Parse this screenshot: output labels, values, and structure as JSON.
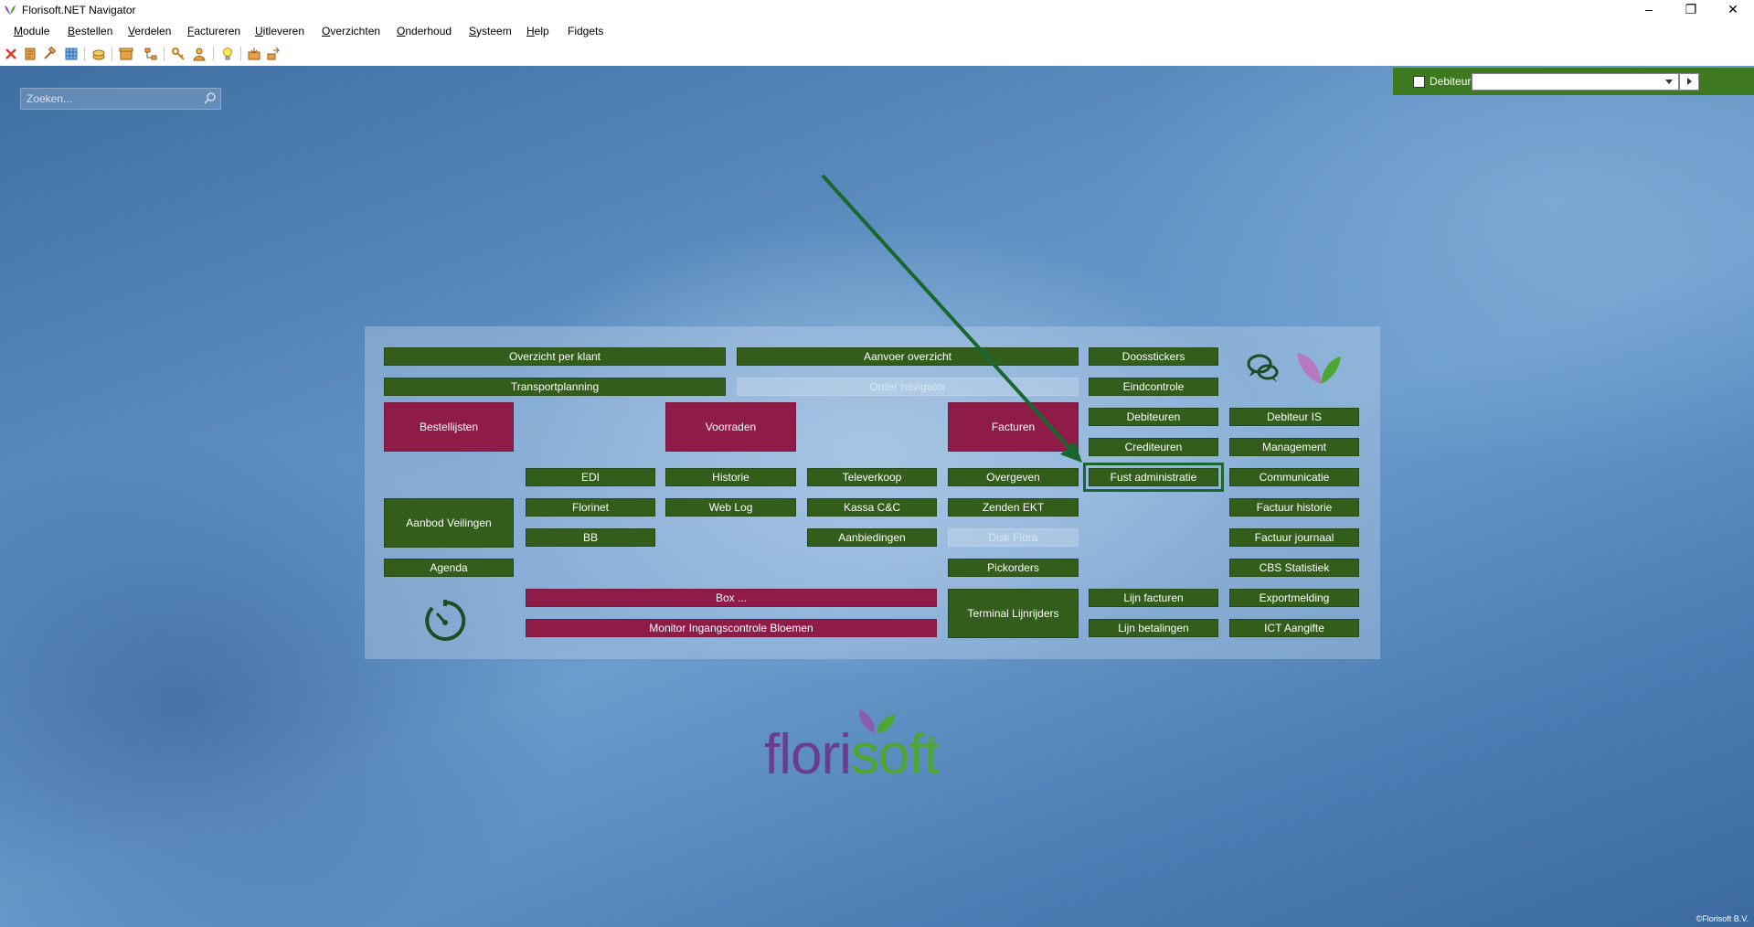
{
  "window": {
    "title": "Florisoft.NET Navigator",
    "minimize": "–",
    "maximize": "❐",
    "close": "✕"
  },
  "menu": [
    {
      "u": "M",
      "rest": "odule"
    },
    {
      "u": "B",
      "rest": "estellen"
    },
    {
      "u": "V",
      "rest": "erdelen"
    },
    {
      "u": "F",
      "rest": "actureren"
    },
    {
      "u": "U",
      "rest": "itleveren"
    },
    {
      "u": "O",
      "rest": "verzichten"
    },
    {
      "u": "O",
      "rest": "nderhoud"
    },
    {
      "u": "S",
      "rest": "ysteem"
    },
    {
      "u": "H",
      "rest": "elp"
    },
    {
      "u": "",
      "rest": "Fidgets"
    }
  ],
  "search": {
    "placeholder": "Zoeken..."
  },
  "debiteur": {
    "label": "Debiteur",
    "value": ""
  },
  "buttons": {
    "overzicht_per_klant": "Overzicht per klant",
    "aanvoer_overzicht": "Aanvoer overzicht",
    "doosstickers": "Doosstickers",
    "transportplanning": "Transportplanning",
    "order_navigator": "Order navigator",
    "eindcontrole": "Eindcontrole",
    "bestellijsten": "Bestellijsten",
    "voorraden": "Voorraden",
    "facturen": "Facturen",
    "debiteuren": "Debiteuren",
    "debiteur_is": "Debiteur IS",
    "crediteuren": "Crediteuren",
    "management": "Management",
    "edi": "EDI",
    "historie": "Historie",
    "televerkoop": "Televerkoop",
    "overgeven": "Overgeven",
    "fust_administratie": "Fust administratie",
    "communicatie": "Communicatie",
    "aanbod_veilingen": "Aanbod Veilingen",
    "florinet": "Florinet",
    "web_log": "Web Log",
    "kassa": "Kassa C&C",
    "zenden_ekt": "Zenden EKT",
    "factuur_historie": "Factuur historie",
    "bb": "BB",
    "aanbiedingen": "Aanbiedingen",
    "disk_flora": "Disk Flora",
    "factuur_journaal": "Factuur journaal",
    "agenda": "Agenda",
    "pickorders": "Pickorders",
    "cbs_statistiek": "CBS Statistiek",
    "box": "Box ...",
    "terminal_lijnrijders": "Terminal Lijnrijders",
    "lijn_facturen": "Lijn facturen",
    "exportmelding": "Exportmelding",
    "monitor": "Monitor Ingangscontrole Bloemen",
    "lijn_betalingen": "Lijn betalingen",
    "ict_aangifte": "ICT Aangifte"
  },
  "brand": {
    "part1": "flori",
    "part2": "soft"
  },
  "copyright": "©Florisoft B.V.",
  "colors": {
    "green_button": "#325d1a",
    "red_button": "#8f1c48",
    "brand_purple": "#6a3d8f",
    "brand_green": "#4da632",
    "annotation_arrow": "#17672e"
  }
}
